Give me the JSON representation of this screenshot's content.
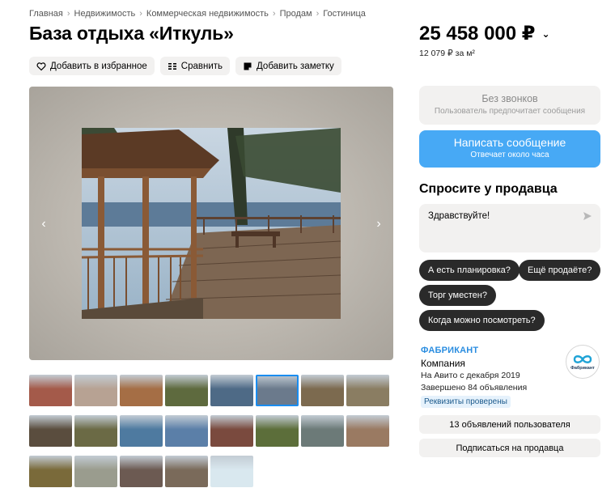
{
  "breadcrumb": [
    "Главная",
    "Недвижимость",
    "Коммерческая недвижимость",
    "Продам",
    "Гостиница"
  ],
  "title": "База отдыха «Иткуль»",
  "actions": {
    "favorite": "Добавить в избранное",
    "compare": "Сравнить",
    "note": "Добавить заметку"
  },
  "gallery": {
    "prev_icon": "chevron-left-icon",
    "next_icon": "chevron-right-icon",
    "main_photo": "wooden gazebo and deck by the lake with pine trees",
    "thumb_colors": [
      [
        "#a45a4a",
        "#b7a293",
        "#a56e45",
        "#5e6a3e",
        "#4e6a86",
        "#6b7a8c",
        "#7c6a4f",
        "#8a7d62"
      ],
      [
        "#5a4d3e",
        "#6b6a45",
        "#4e7aa0",
        "#5b7fa8",
        "#7a4a3e",
        "#5c6e3a",
        "#6c7a78",
        "#9a7a62"
      ],
      [
        "#7a6a3a",
        "#9a9c8e",
        "#6c5a52",
        "#7a6a5a",
        "#d9e8ef"
      ]
    ],
    "active_thumb": 5
  },
  "price": {
    "value": "25 458 000 ₽",
    "per_m2": "12 079 ₽ за м²"
  },
  "contact": {
    "no_calls_title": "Без звонков",
    "no_calls_sub": "Пользователь предпочитает сообщения",
    "write_title": "Написать сообщение",
    "write_sub": "Отвечает около часа"
  },
  "ask": {
    "title": "Спросите у продавца",
    "message": "Здравствуйте!",
    "chips": [
      "А есть планировка?",
      "Ещё продаёте?",
      "Торг уместен?",
      "Когда можно посмотреть?"
    ]
  },
  "seller": {
    "name": "ФАБРИКАНТ",
    "type": "Компания",
    "since": "На Авито с декабря 2019",
    "completed": "Завершено 84 объявления",
    "verified": "Реквизиты проверены",
    "logo_text": "Фабрикант",
    "listings_button": "13 объявлений пользователя",
    "subscribe_button": "Подписаться на продавца"
  },
  "colors": {
    "accent_blue": "#47a9f5",
    "chip_dark": "#2a2a2a",
    "grey_button": "#f2f1f0",
    "seller_link": "#2a8de0"
  }
}
